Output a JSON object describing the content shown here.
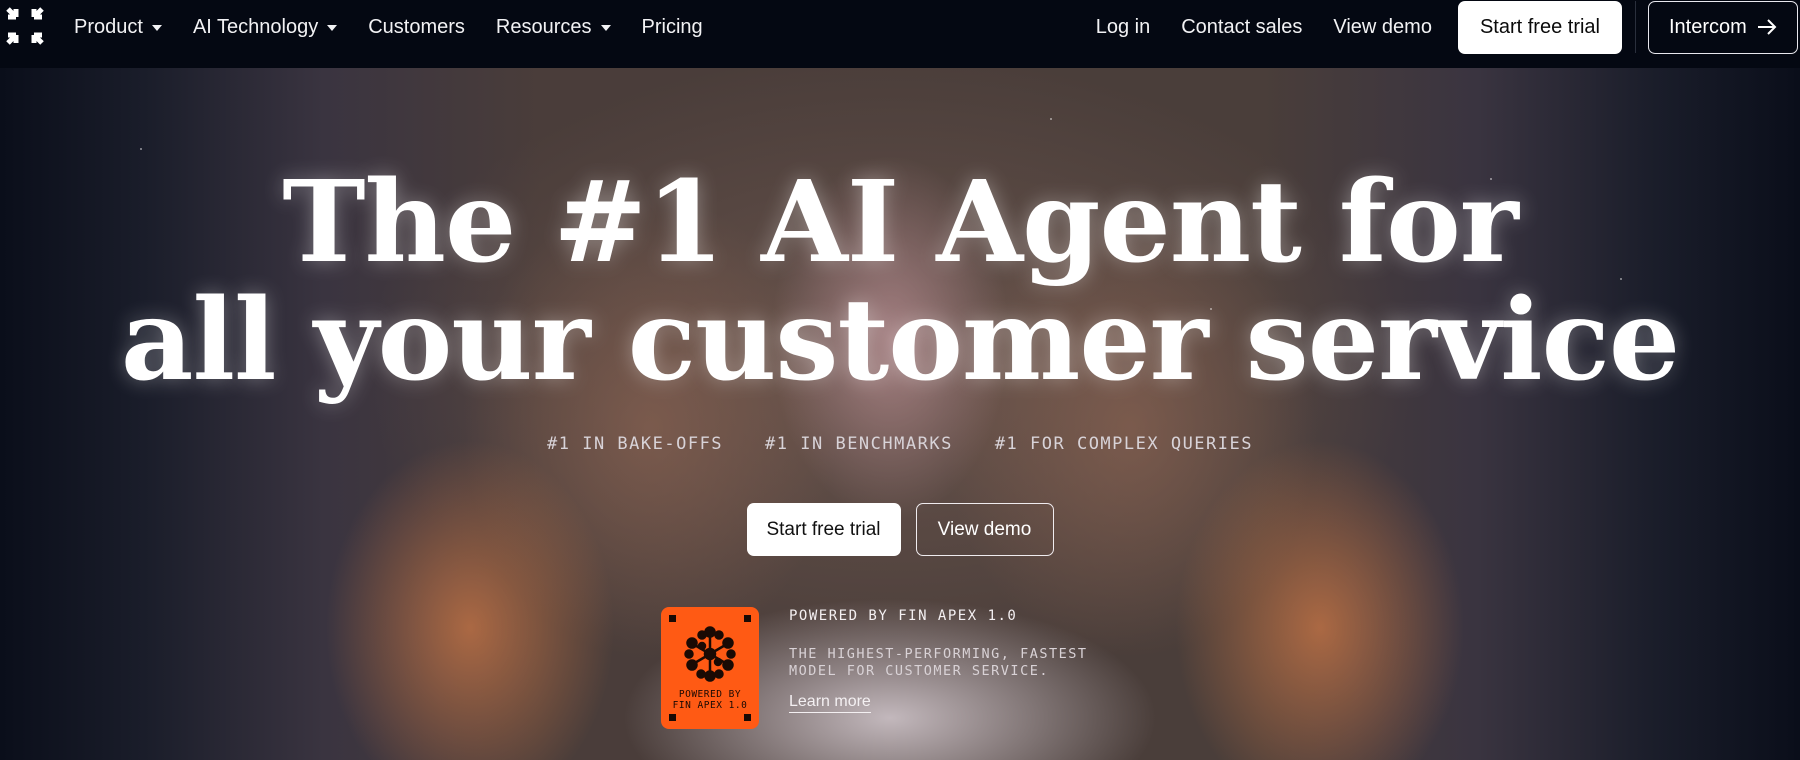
{
  "nav": {
    "logo_icon": "intercom-logo-icon",
    "items": [
      {
        "label": "Product",
        "has_dropdown": true
      },
      {
        "label": "AI Technology",
        "has_dropdown": true
      },
      {
        "label": "Customers",
        "has_dropdown": false
      },
      {
        "label": "Resources",
        "has_dropdown": true
      },
      {
        "label": "Pricing",
        "has_dropdown": false
      }
    ],
    "login": "Log in",
    "contact_sales": "Contact sales",
    "view_demo": "View demo",
    "start_trial": "Start free trial",
    "intercom": "Intercom",
    "intercom_icon": "arrow-right-icon"
  },
  "hero": {
    "title_line1": "The #1 AI Agent for",
    "title_line2": "all your customer service",
    "tags": [
      "#1 IN BAKE-OFFS",
      "#1 IN BENCHMARKS",
      "#1 FOR COMPLEX QUERIES"
    ],
    "cta_primary": "Start free trial",
    "cta_secondary": "View demo"
  },
  "fin": {
    "badge_line1": "POWERED BY",
    "badge_line2": "FIN APEX 1.0",
    "badge_icon": "fin-network-icon",
    "badge_color": "#ff5a14",
    "title": "POWERED BY FIN APEX 1.0",
    "desc_line1": "THE HIGHEST-PERFORMING, FASTEST",
    "desc_line2": "MODEL FOR CUSTOMER SERVICE.",
    "learn_more": "Learn more"
  }
}
